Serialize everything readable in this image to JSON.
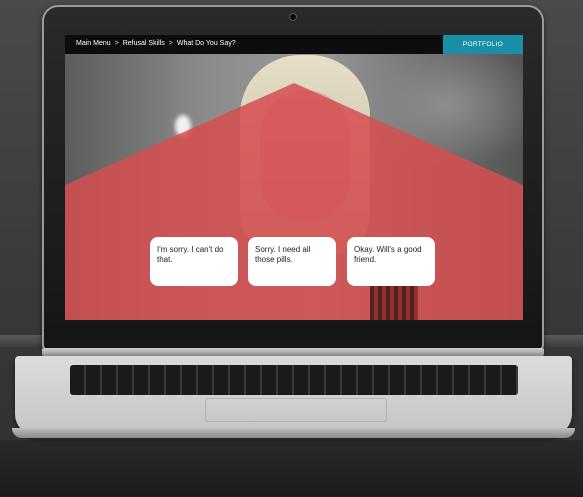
{
  "breadcrumb": {
    "items": [
      "Main Menu",
      "Refusal Skills",
      "What Do You Say?"
    ],
    "separator": ">"
  },
  "header": {
    "portfolio_label": "PORTFOLIO"
  },
  "choices": [
    {
      "text": "I'm sorry. I can't do that."
    },
    {
      "text": "Sorry. I need all those pills."
    },
    {
      "text": "Okay. Will's a good friend."
    }
  ],
  "colors": {
    "accent": "#1a8fa8",
    "overlay_red": "#d64e50",
    "topbar": "#0d0d0d"
  }
}
